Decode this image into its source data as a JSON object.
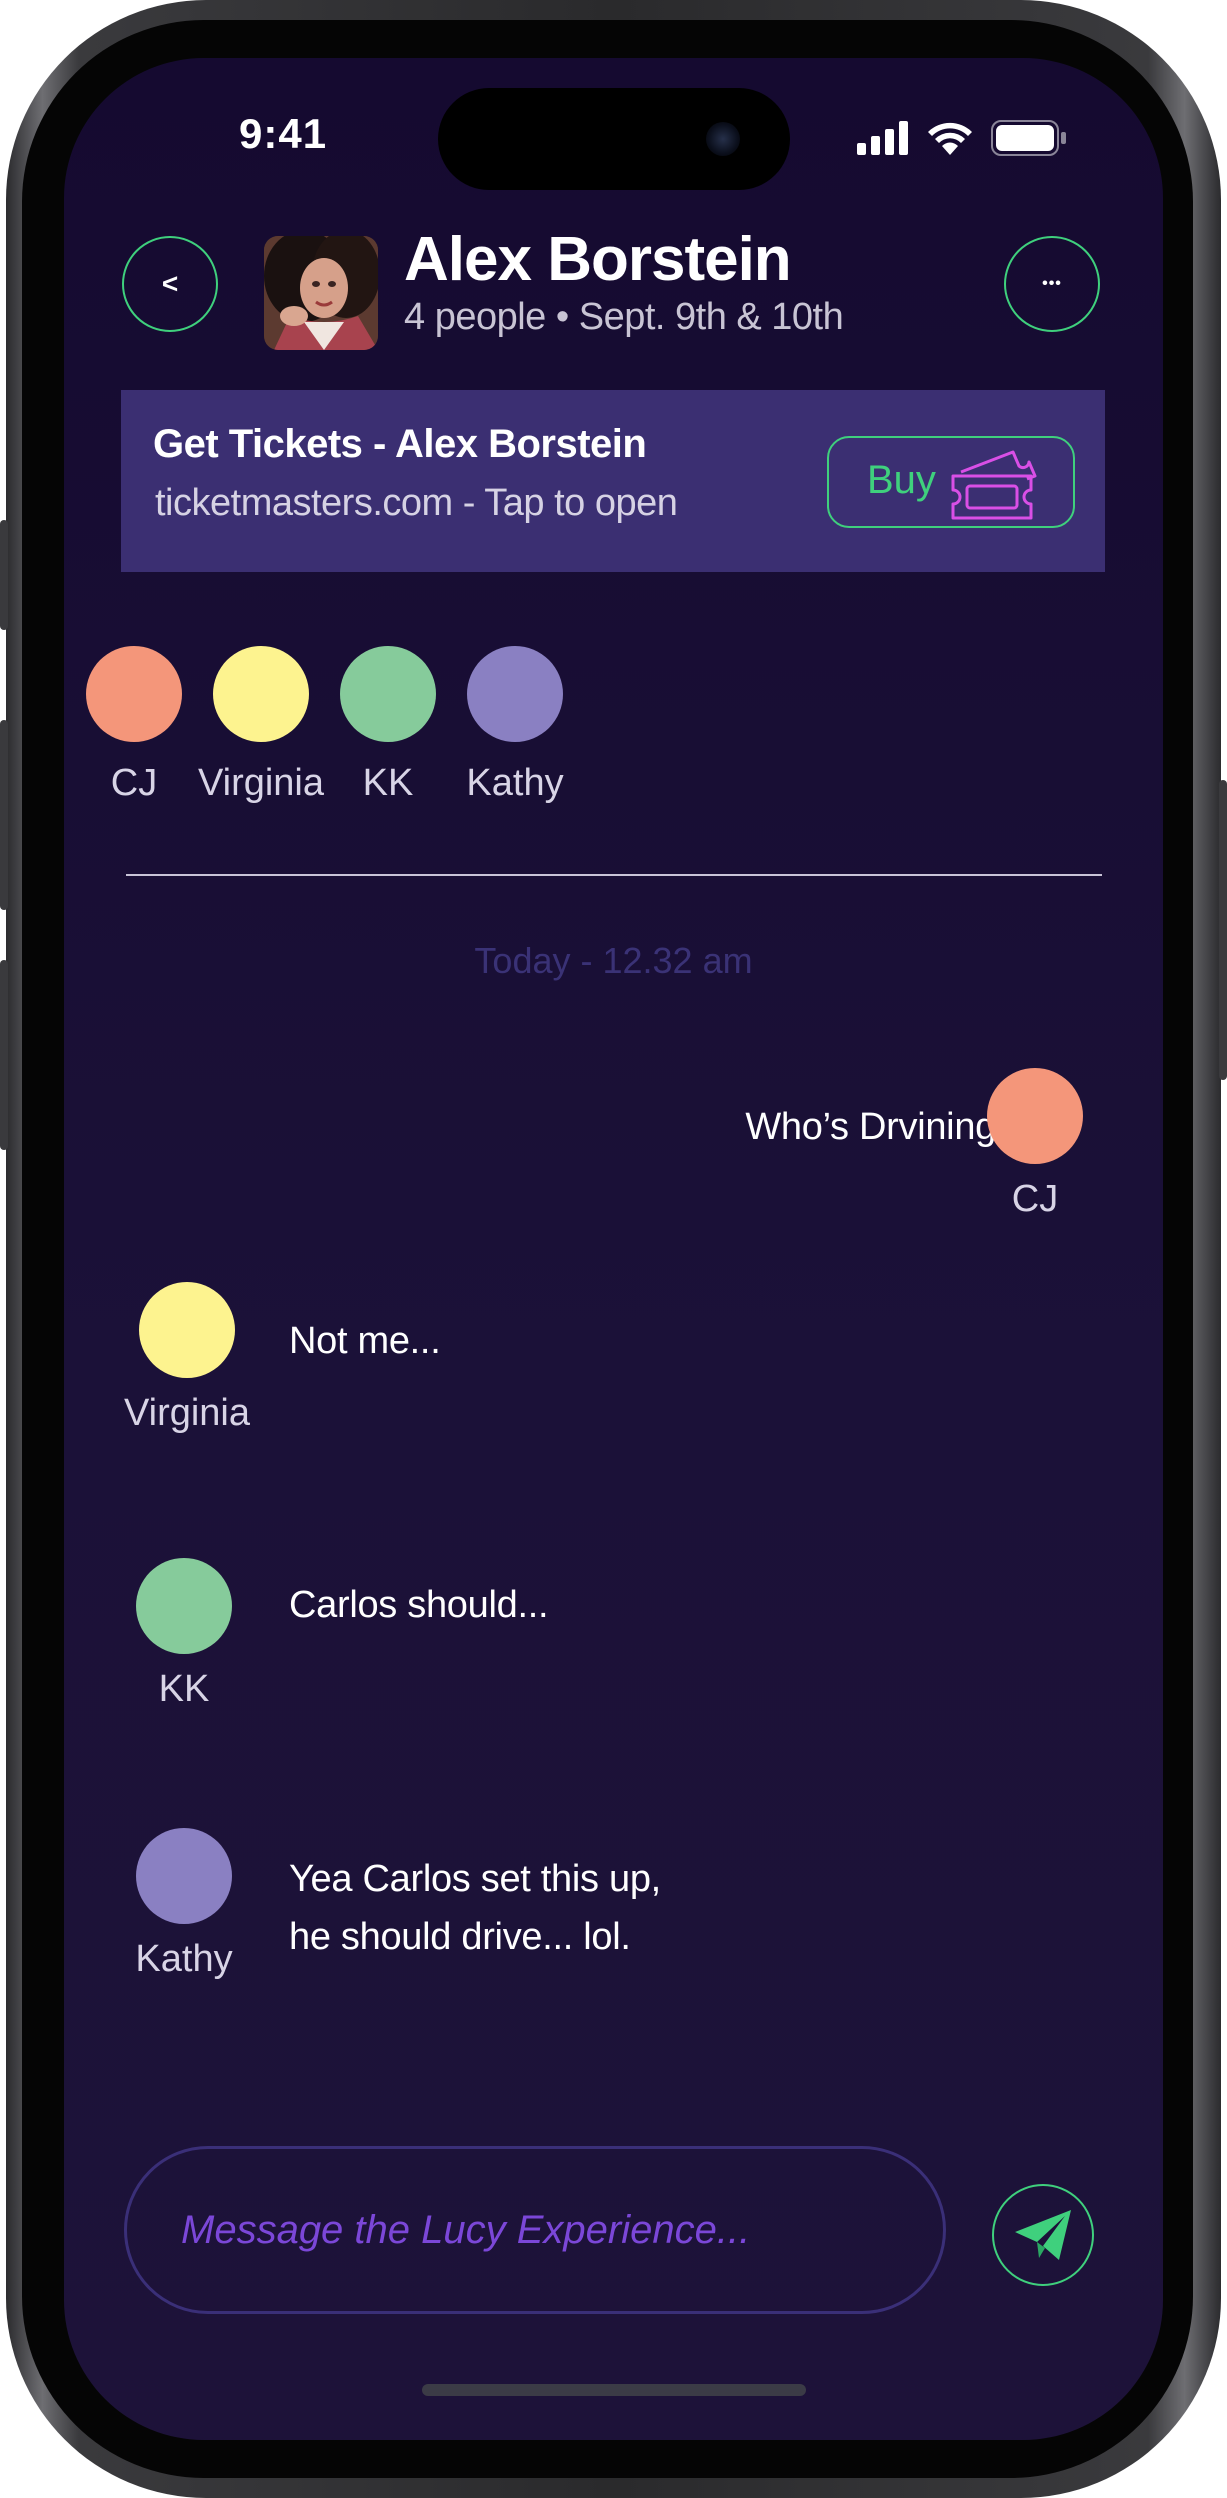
{
  "status_bar": {
    "time": "9:41"
  },
  "header": {
    "back_label": "<",
    "more_label": "•••",
    "title": "Alex Borstein",
    "subtitle": "4 people • Sept. 9th & 10th"
  },
  "banner": {
    "title": "Get Tickets - Alex Borstein",
    "subtitle": "ticketmasters.com - Tap to open",
    "buy_label": "Buy"
  },
  "participants": [
    {
      "name": "CJ",
      "color": "#f4967a"
    },
    {
      "name": "Virginia",
      "color": "#fdf38f"
    },
    {
      "name": "KK",
      "color": "#86cb9b"
    },
    {
      "name": "Kathy",
      "color": "#8a80c2"
    }
  ],
  "timestamp": "Today - 12.32 am",
  "messages": [
    {
      "sender": "CJ",
      "color": "#f4967a",
      "text": "Who’s Drvining",
      "side": "right"
    },
    {
      "sender": "Virginia",
      "color": "#fdf38f",
      "text": "Not me...",
      "side": "left"
    },
    {
      "sender": "KK",
      "color": "#86cb9b",
      "text": "Carlos should...",
      "side": "left"
    },
    {
      "sender": "Kathy",
      "color": "#8a80c2",
      "lines": [
        "Yea Carlos set this up,",
        "he should drive... lol."
      ],
      "side": "left"
    }
  ],
  "composer": {
    "placeholder": "Message the Lucy Experience..."
  },
  "colors": {
    "accent": "#3fd07d",
    "banner_bg": "#3b2f72",
    "ticket_icon": "#d94fe6",
    "placeholder": "#7b47d8"
  }
}
